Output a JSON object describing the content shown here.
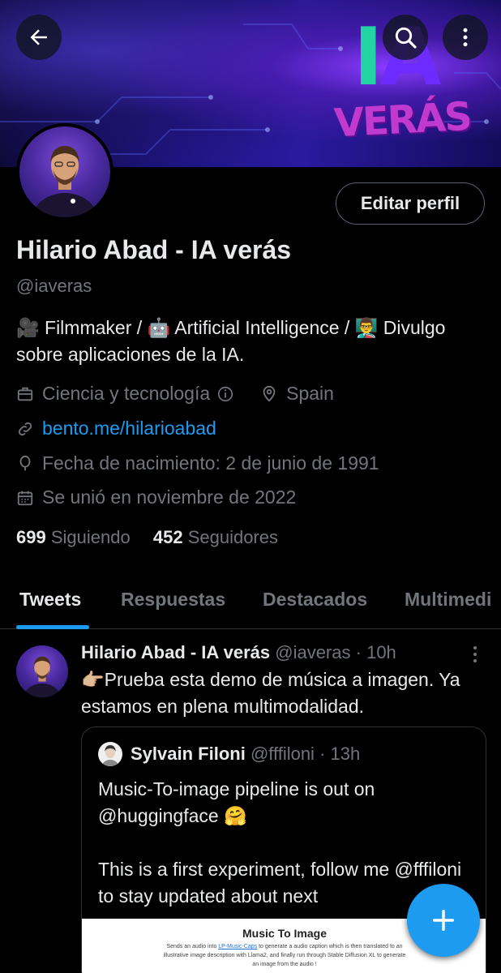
{
  "header": {
    "back_icon": "arrow-left-icon",
    "search_icon": "search-icon",
    "more_icon": "more-vertical-icon",
    "banner_logo_ia": "IA",
    "banner_logo_veras": "VERÁS"
  },
  "profile": {
    "edit_label": "Editar perfil",
    "name": "Hilario Abad - IA verás",
    "handle": "@iaveras",
    "bio": "🎥 Filmmaker / 🤖 Artificial Intelligence / 👨‍🏫 Divulgo sobre aplicaciones de la IA.",
    "category": "Ciencia y tecnología",
    "location": "Spain",
    "website": "bento.me/hilarioabad",
    "birth": "Fecha de nacimiento: 2 de junio de 1991",
    "joined": "Se unió en noviembre de 2022",
    "following_count": "699",
    "following_label": "Siguiendo",
    "followers_count": "452",
    "followers_label": "Seguidores"
  },
  "tabs": [
    {
      "label": "Tweets",
      "active": true
    },
    {
      "label": "Respuestas",
      "active": false
    },
    {
      "label": "Destacados",
      "active": false
    },
    {
      "label": "Multimedi",
      "active": false
    }
  ],
  "tweet": {
    "author": "Hilario Abad - IA verás",
    "handle": "@iaveras",
    "separator": "·",
    "time": "10h",
    "text": "👉🏼Prueba esta demo de música a imagen. Ya estamos en plena multimodalidad.",
    "quote": {
      "author": "Sylvain Filoni",
      "handle": "@fffiloni",
      "separator": "·",
      "time": "13h",
      "text": "Music-To-image pipeline is out on @huggingface 🤗\n\nThis is a first experiment, follow me @fffiloni to stay updated about next",
      "image_title": "Music To Image",
      "image_desc_pre": "Sends an audio into ",
      "image_desc_link": "LP-Music-Caps",
      "image_desc_post": " to generate a audio caption which is then translated to an illustrative image description with Llama2, and finally run through Stable Diffusion XL to generate an image from the audio !"
    }
  },
  "fab": {
    "icon": "plus-icon"
  },
  "colors": {
    "accent": "#1d9bf0",
    "text_primary": "#e7e9ea",
    "text_secondary": "#71767b",
    "border": "#2f3336",
    "background": "#000000"
  }
}
